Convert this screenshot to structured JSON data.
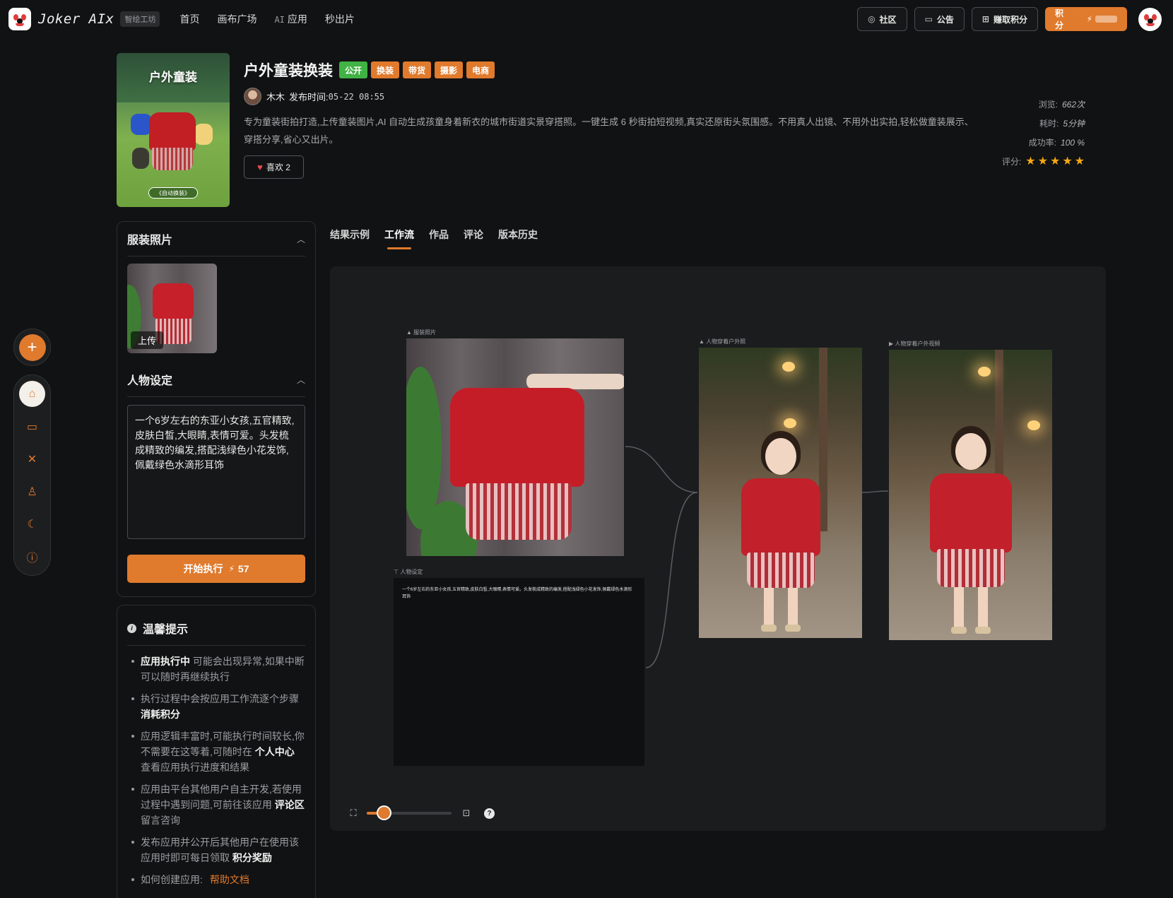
{
  "header": {
    "brand": "Joker AIx",
    "brand_badge": "智绘工坊",
    "nav": [
      "首页",
      "画布广场",
      "应用",
      "秒出片"
    ],
    "nav_ai_prefix": "AI",
    "community": "社区",
    "announcement": "公告",
    "earn_points": "赚取积分",
    "points_label": "积分",
    "points_icon": "⚡"
  },
  "app": {
    "title": "户外童装换装",
    "cover_title": "户外童装",
    "cover_tag": "《自动换装》",
    "tags": [
      "公开",
      "换装",
      "带货",
      "摄影",
      "电商"
    ],
    "author": "木木",
    "publish_label": "发布时间:",
    "publish_time": "05-22 08:55",
    "description": "专为童装街拍打造,上传童装图片,AI 自动生成孩童身着新衣的城市街道实景穿搭照。一键生成 6 秒街拍短视频,真实还原街头氛围感。不用真人出镜、不用外出实拍,轻松做童装展示、穿搭分享,省心又出片。",
    "like_label": "喜欢",
    "like_count": "2",
    "stats": {
      "views_label": "浏览:",
      "views": "662次",
      "time_label": "耗时:",
      "time": "5分钟",
      "success_label": "成功率:",
      "success": "100 %",
      "rating_label": "评分:",
      "rating": 5
    }
  },
  "panel": {
    "clothing_title": "服装照片",
    "upload_label": "上传",
    "persona_title": "人物设定",
    "persona_text": "一个6岁左右的东亚小女孩,五官精致,皮肤白皙,大眼睛,表情可爱。头发梳成精致的编发,搭配浅绿色小花发饰,佩戴绿色水滴形耳饰",
    "run_label": "开始执行",
    "run_cost": "57"
  },
  "tips": {
    "title": "温馨提示",
    "items": [
      {
        "strong": "应用执行中",
        "text": "可能会出现异常,如果中断可以随时再继续执行"
      },
      {
        "text": "执行过程中会按应用工作流逐个步骤",
        "strong": "消耗积分"
      },
      {
        "text": "应用逻辑丰富时,可能执行时间较长,你不需要在这等着,可随时在",
        "strong": "个人中心",
        "text2": "查看应用执行进度和结果"
      },
      {
        "text": "应用由平台其他用户自主开发,若使用过程中遇到问题,可前往该应用",
        "strong": "评论区",
        "text2": "留言咨询"
      },
      {
        "text": "发布应用并公开后其他用户在使用该应用时即可每日领取",
        "strong": "积分奖励"
      },
      {
        "text": "如何创建应用:",
        "link": "帮助文档"
      }
    ]
  },
  "tabs": [
    "结果示例",
    "工作流",
    "作品",
    "评论",
    "版本历史"
  ],
  "active_tab": "工作流",
  "workflow": {
    "node_clothing": "服装照片",
    "node_persona": "人物设定",
    "node_photo": "人物穿着户外照",
    "node_video": "人物穿着户外视频",
    "persona_text": "一个6岁左右的东亚小女孩,五官精致,皮肤白皙,大眼睛,表情可爱。头发梳成精致的编发,搭配浅绿色小花发饰,佩戴绿色水滴形耳饰",
    "zoom": 0.2
  },
  "colors": {
    "accent": "#e07a2d",
    "public_tag": "#41b244",
    "background": "#111213",
    "star": "#f3a712"
  },
  "icons": {
    "community": "chat-bubble-icon",
    "announcement": "message-icon",
    "earn_points": "gift-icon",
    "rail": [
      "home-icon",
      "folder-icon",
      "tools-icon",
      "user-icon",
      "moon-icon",
      "alert-icon"
    ]
  }
}
